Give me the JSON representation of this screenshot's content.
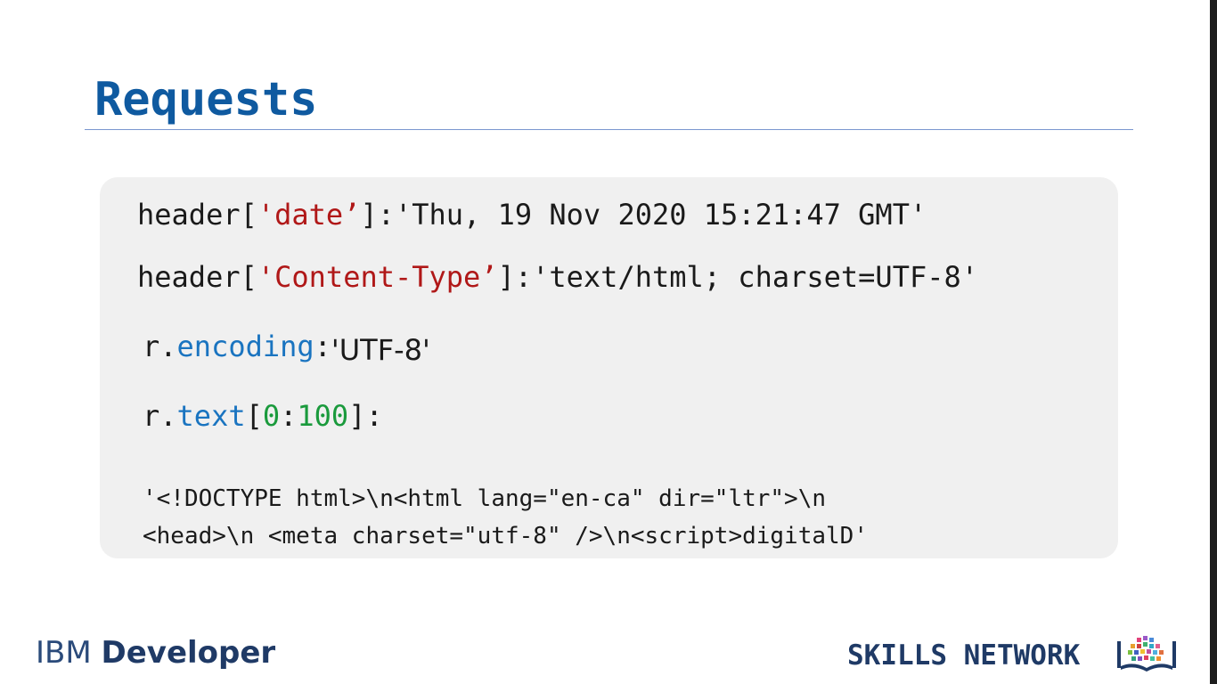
{
  "slide": {
    "title": "Requests"
  },
  "code": {
    "line1": {
      "prefix": "header[",
      "key": "'date’",
      "suffix": "]:'Thu, 19 Nov 2020 15:21:47 GMT'"
    },
    "line2": {
      "prefix": "header[",
      "key": "'Content-Type’",
      "suffix": "]:'text/html; charset=UTF-8'"
    },
    "line3": {
      "obj": "r.",
      "attr": "encoding",
      "sep": ":",
      "value": "'UTF-8'"
    },
    "line4": {
      "obj": "r.",
      "attr": "text",
      "open": "[",
      "start": "0",
      "colon": ":",
      "end": "100",
      "close": "]:"
    },
    "output": {
      "line1": "'<!DOCTYPE html>\\n<html lang=\"en-ca\" dir=\"ltr\">\\n",
      "line2": "<head>\\n <meta charset=\"utf-8\" />\\n<script>digitalD'"
    }
  },
  "footer": {
    "ibm_light": "IBM ",
    "ibm_bold": "Developer",
    "skills": "SKILLS NETWORK"
  },
  "colors": {
    "title": "#0f5aa0",
    "string_key": "#b01818",
    "attribute": "#1a74c0",
    "number": "#1a9a3c",
    "code_box_bg": "#f0f0f0"
  },
  "icons": {
    "skills_logo": "skills-network-logo-icon"
  }
}
